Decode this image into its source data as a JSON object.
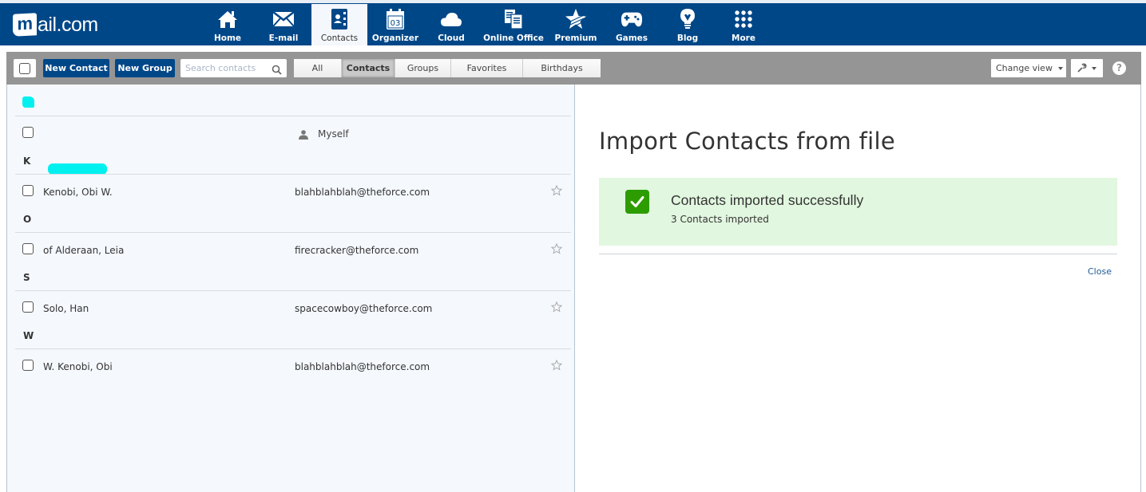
{
  "app": {
    "logo_text": "ail.com",
    "logo_m": "m",
    "brand_color": "#004788"
  },
  "nav": {
    "items": [
      {
        "label": "Home",
        "icon": "home-icon"
      },
      {
        "label": "E-mail",
        "icon": "envelope-icon"
      },
      {
        "label": "Contacts",
        "icon": "address-book-icon",
        "active": true
      },
      {
        "label": "Organizer",
        "icon": "calendar-icon",
        "calendar_day": "03"
      },
      {
        "label": "Cloud",
        "icon": "cloud-icon"
      },
      {
        "label": "Online Office",
        "icon": "documents-icon"
      },
      {
        "label": "Premium",
        "icon": "star-icon"
      },
      {
        "label": "Games",
        "icon": "gamepad-icon"
      },
      {
        "label": "Blog",
        "icon": "lightbulb-icon"
      },
      {
        "label": "More",
        "icon": "grid-dots-icon"
      }
    ]
  },
  "toolbar": {
    "new_contact": "New Contact",
    "new_group": "New Group",
    "search_placeholder": "Search contacts",
    "search_value": "",
    "filter_tabs": [
      {
        "label": "All"
      },
      {
        "label": "Contacts",
        "active": true
      },
      {
        "label": "Groups"
      },
      {
        "label": "Favorites"
      },
      {
        "label": "Birthdays"
      }
    ],
    "change_view": "Change view",
    "help": "?"
  },
  "contacts": {
    "self": {
      "tag": "Myself"
    },
    "groups": [
      {
        "letter": "K",
        "rows": [
          {
            "name": "Kenobi, Obi W.",
            "email": "blahblahblah@theforce.com",
            "favorite": false
          }
        ]
      },
      {
        "letter": "O",
        "rows": [
          {
            "name": "of Alderaan, Leia",
            "email": "firecracker@theforce.com",
            "favorite": false
          }
        ]
      },
      {
        "letter": "S",
        "rows": [
          {
            "name": "Solo, Han",
            "email": "spacecowboy@theforce.com",
            "favorite": false
          }
        ]
      },
      {
        "letter": "W",
        "rows": [
          {
            "name": "W. Kenobi, Obi",
            "email": "blahblahblah@theforce.com",
            "favorite": false
          }
        ]
      }
    ]
  },
  "detail": {
    "title": "Import Contacts from file",
    "success_message": "Contacts imported successfully",
    "success_sub": "3 Contacts imported",
    "success_color": "#2d9c00",
    "close": "Close"
  }
}
